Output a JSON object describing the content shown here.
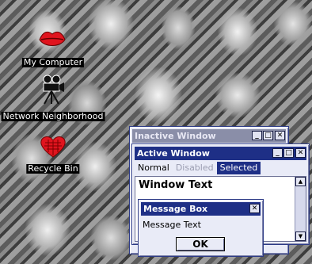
{
  "desktop": {
    "icons": [
      {
        "label": "My Computer",
        "icon": "red-lips-icon"
      },
      {
        "label": "Network Neighborhood",
        "icon": "film-camera-icon"
      },
      {
        "label": "Recycle Bin",
        "icon": "red-heart-icon"
      }
    ]
  },
  "inactive_window": {
    "title": "Inactive Window",
    "buttons": {
      "minimize": "_",
      "maximize": "□",
      "close": "✕"
    }
  },
  "active_window": {
    "title": "Active Window",
    "buttons": {
      "minimize": "_",
      "maximize": "□",
      "close": "✕"
    },
    "menu": {
      "normal": "Normal",
      "disabled": "Disabled",
      "selected": "Selected"
    },
    "window_text": "Window Text",
    "scroll_up": "▲",
    "scroll_down": "▼"
  },
  "message_box": {
    "title": "Message Box",
    "close": "✕",
    "text": "Message Text",
    "ok_label": "OK"
  },
  "colors": {
    "active_title": "#1e2f86",
    "inactive_title": "#8a8ea8",
    "window_face": "#e9ebf7",
    "icon_red": "#e0141e"
  }
}
